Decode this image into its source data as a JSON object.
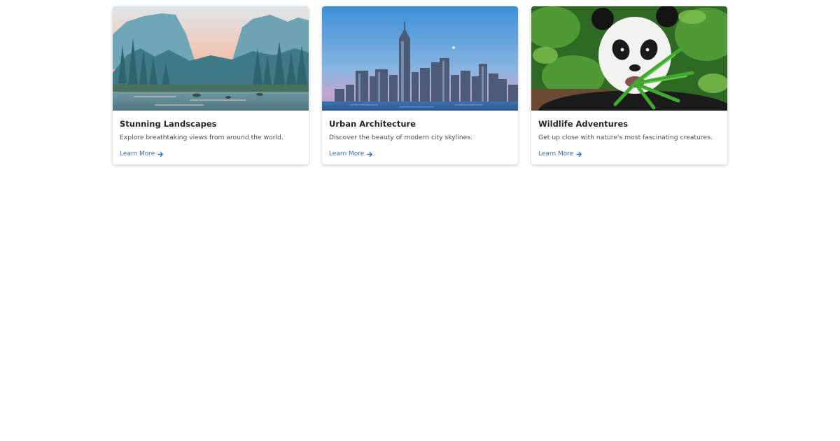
{
  "cards": [
    {
      "title": "Stunning Landscapes",
      "description": "Explore breathtaking views from around the world.",
      "link_label": "Learn More",
      "image_icon": "mountain-landscape-photo",
      "link_icon": "arrow-right-icon"
    },
    {
      "title": "Urban Architecture",
      "description": "Discover the beauty of modern city skylines.",
      "link_label": "Learn More",
      "image_icon": "city-skyline-photo",
      "link_icon": "arrow-right-icon"
    },
    {
      "title": "Wildlife Adventures",
      "description": "Get up close with nature's most fascinating creatures.",
      "link_label": "Learn More",
      "image_icon": "panda-photo",
      "link_icon": "arrow-right-icon"
    }
  ],
  "colors": {
    "link": "#2f72c8",
    "title": "#1f2430",
    "description": "#4b5160",
    "background": "#ffffff"
  }
}
